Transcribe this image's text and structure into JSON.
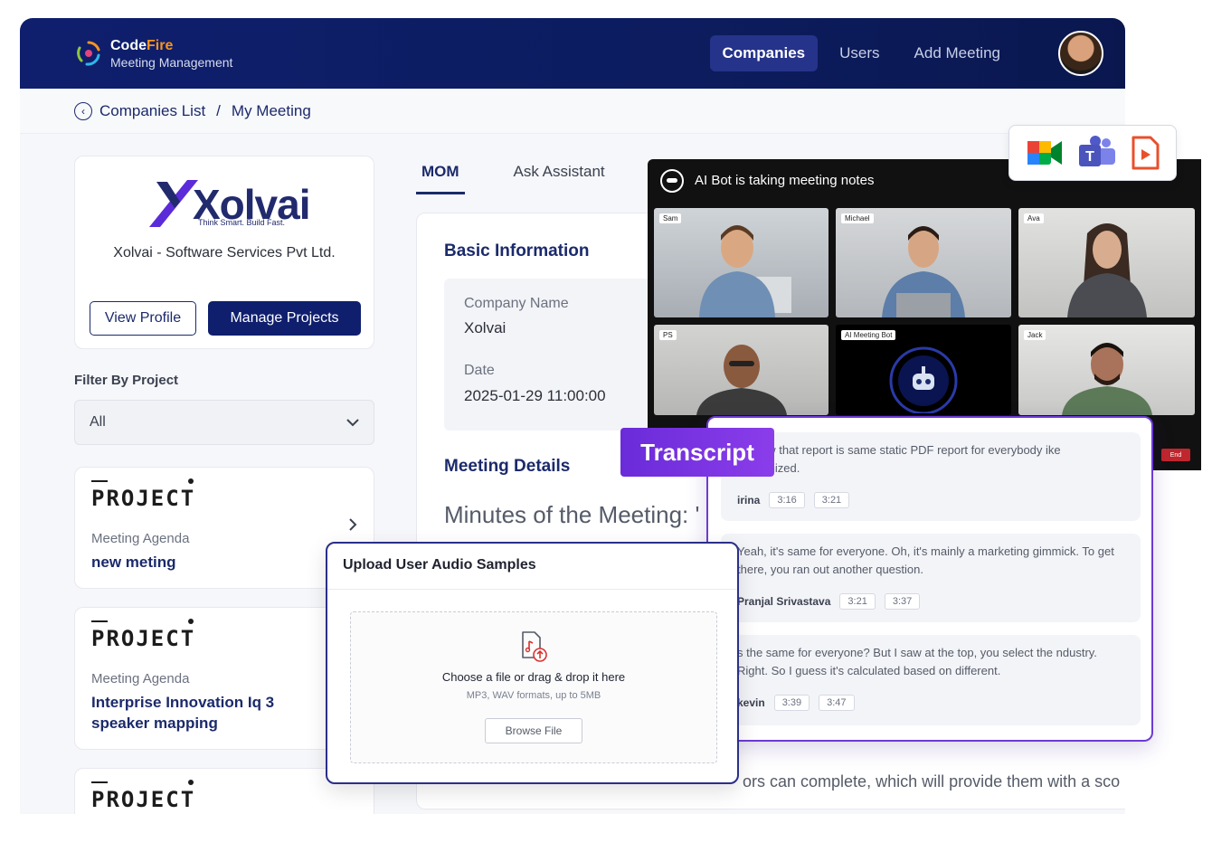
{
  "brand": {
    "name_part1": "Code",
    "name_part2": "Fire",
    "subtitle": "Meeting Management"
  },
  "nav": {
    "items": [
      {
        "label": "Companies",
        "active": true
      },
      {
        "label": "Users"
      },
      {
        "label": "Add Meeting"
      }
    ]
  },
  "breadcrumb": {
    "parent": "Companies List",
    "separator": "/",
    "current": "My Meeting"
  },
  "company": {
    "logo_text": "Xolvai",
    "tagline": "Think Smart. Build Fast.",
    "name": "Xolvai - Software Services Pvt Ltd.",
    "view_profile_label": "View Profile",
    "manage_projects_label": "Manage Projects"
  },
  "filter": {
    "label": "Filter By Project",
    "selected": "All"
  },
  "projects": [
    {
      "logo": "PROJECT",
      "agenda_label": "Meeting Agenda",
      "title": "new meting"
    },
    {
      "logo": "PROJECT",
      "agenda_label": "Meeting Agenda",
      "title": "Interprise Innovation Iq 3 speaker mapping"
    },
    {
      "logo": "PROJECT"
    }
  ],
  "tabs": [
    {
      "label": "MOM",
      "active": true
    },
    {
      "label": "Ask Assistant"
    }
  ],
  "mom": {
    "basic_info_heading": "Basic Information",
    "company_name_label": "Company Name",
    "company_name_value": "Xolvai",
    "date_label": "Date",
    "date_value": "2025-01-29 11:00:00",
    "meeting_details_heading": "Meeting Details",
    "minutes_title": "Minutes of the Meeting: '",
    "bottom_text": "ors can complete, which will provide them with a sco"
  },
  "meeting": {
    "header": "AI Bot is taking meeting notes",
    "participants": [
      "Sam",
      "Michael",
      "Ava",
      "PS",
      "AI Meeting Bot",
      "Jack"
    ],
    "end_label": "End"
  },
  "app_icons": [
    "google-meet-icon",
    "microsoft-teams-icon",
    "recording-file-icon"
  ],
  "transcript": {
    "tag": "Transcript",
    "entries": [
      {
        "text": "for now that report is same static PDF report for everybody ike customized.",
        "speaker": "irina",
        "start": "3:16",
        "end": "3:21"
      },
      {
        "text": "Yeah, it's same for everyone. Oh, it's mainly a marketing gimmick. To get there, you ran out another question.",
        "speaker": "Pranjal Srivastava",
        "start": "3:21",
        "end": "3:37"
      },
      {
        "text": "s the same for everyone? But I saw at the top, you select the ndustry. Right. So I guess it's calculated based on different.",
        "speaker": "kevin",
        "start": "3:39",
        "end": "3:47"
      }
    ]
  },
  "upload": {
    "title": "Upload User Audio Samples",
    "main_text": "Choose a file or drag & drop it here",
    "sub_text": "MP3, WAV formats, up to 5MB",
    "browse_label": "Browse File"
  },
  "colors": {
    "navy": "#0f1f6e",
    "purple": "#6c3bd5",
    "accent_orange": "#f7941d"
  }
}
